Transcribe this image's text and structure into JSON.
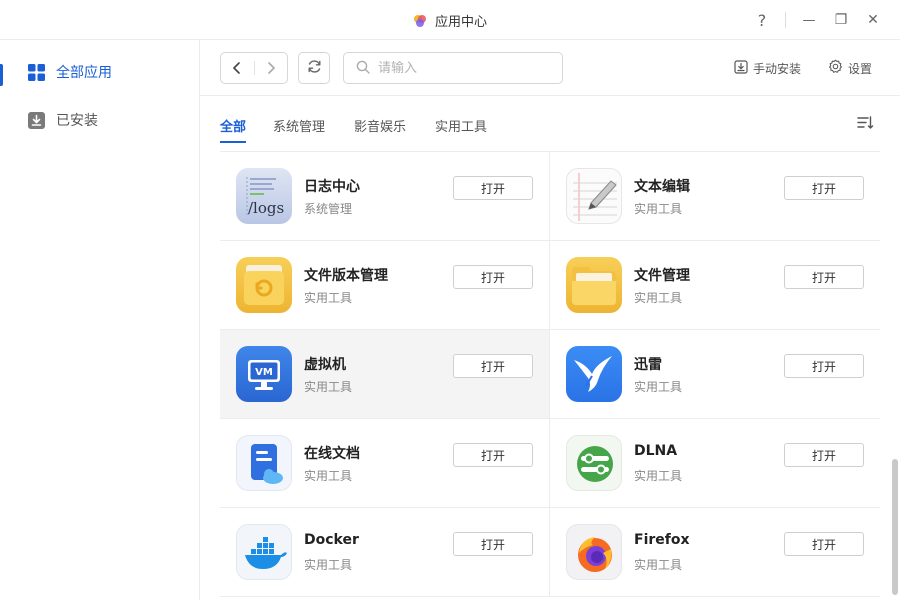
{
  "window": {
    "title": "应用中心",
    "controls": {
      "help": "?",
      "minimize": "—",
      "maximize": "❐",
      "close": "✕"
    }
  },
  "sidebar": {
    "items": [
      {
        "label": "全部应用",
        "icon": "grid-icon",
        "active": true
      },
      {
        "label": "已安装",
        "icon": "download-box-icon",
        "active": false
      }
    ]
  },
  "toolbar": {
    "search_placeholder": "请输入",
    "manual_install_label": "手动安装",
    "settings_label": "设置"
  },
  "tabs": [
    {
      "label": "全部",
      "active": true
    },
    {
      "label": "系统管理",
      "active": false
    },
    {
      "label": "影音娱乐",
      "active": false
    },
    {
      "label": "实用工具",
      "active": false
    }
  ],
  "apps": [
    {
      "name": "日志中心",
      "category": "系统管理",
      "icon": "logs-icon",
      "button": "打开",
      "icon_text": "/logs"
    },
    {
      "name": "文本编辑",
      "category": "实用工具",
      "icon": "text-editor-icon",
      "button": "打开"
    },
    {
      "name": "文件版本管理",
      "category": "实用工具",
      "icon": "file-version-icon",
      "button": "打开"
    },
    {
      "name": "文件管理",
      "category": "实用工具",
      "icon": "folder-icon",
      "button": "打开"
    },
    {
      "name": "虚拟机",
      "category": "实用工具",
      "icon": "vm-icon",
      "button": "打开",
      "icon_text": "VM",
      "hovered": true
    },
    {
      "name": "迅雷",
      "category": "实用工具",
      "icon": "thunder-bird-icon",
      "button": "打开"
    },
    {
      "name": "在线文档",
      "category": "实用工具",
      "icon": "online-doc-icon",
      "button": "打开"
    },
    {
      "name": "DLNA",
      "category": "实用工具",
      "icon": "dlna-icon",
      "button": "打开"
    },
    {
      "name": "Docker",
      "category": "实用工具",
      "icon": "docker-icon",
      "button": "打开"
    },
    {
      "name": "Firefox",
      "category": "实用工具",
      "icon": "firefox-icon",
      "button": "打开"
    }
  ],
  "colors": {
    "accent": "#1a5fd6",
    "border": "#ececec"
  }
}
